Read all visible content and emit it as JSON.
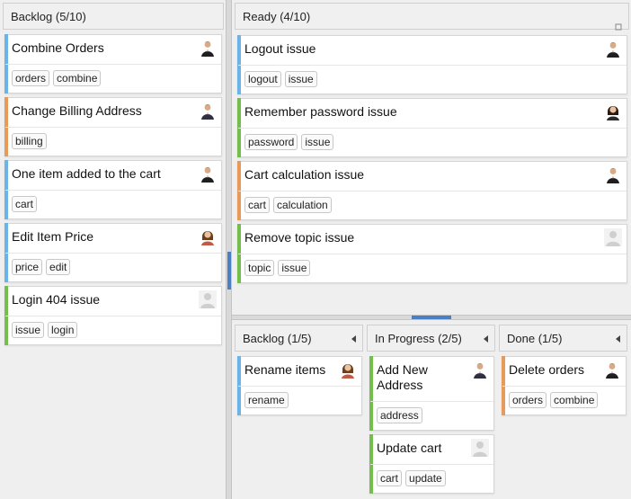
{
  "colors": {
    "blue": "#6ab4e8",
    "orange": "#e79a5a",
    "green": "#73be4c"
  },
  "left": {
    "header": "Backlog (5/10)",
    "cards": [
      {
        "title": "Combine Orders",
        "tags": [
          "orders",
          "combine"
        ],
        "color": "blue",
        "avatar": "man-suit"
      },
      {
        "title": "Change Billing Address",
        "tags": [
          "billing"
        ],
        "color": "orange",
        "avatar": "man-suit-2"
      },
      {
        "title": "One item added to the cart",
        "tags": [
          "cart"
        ],
        "color": "blue",
        "avatar": "man-suit"
      },
      {
        "title": "Edit Item Price",
        "tags": [
          "price",
          "edit"
        ],
        "color": "blue",
        "avatar": "woman"
      },
      {
        "title": "Login 404 issue",
        "tags": [
          "issue",
          "login"
        ],
        "color": "green",
        "avatar": "placeholder"
      }
    ]
  },
  "ready": {
    "header": "Ready (4/10)",
    "cards": [
      {
        "title": "Logout issue",
        "tags": [
          "logout",
          "issue"
        ],
        "color": "blue",
        "avatar": "man-suit"
      },
      {
        "title": "Remember password issue",
        "tags": [
          "password",
          "issue"
        ],
        "color": "green",
        "avatar": "woman-dark"
      },
      {
        "title": "Cart calculation issue",
        "tags": [
          "cart",
          "calculation"
        ],
        "color": "orange",
        "avatar": "man-suit"
      },
      {
        "title": "Remove topic issue",
        "tags": [
          "topic",
          "issue"
        ],
        "color": "green",
        "avatar": "placeholder"
      }
    ]
  },
  "bottom": {
    "columns": [
      {
        "header": "Backlog (1/5)",
        "cards": [
          {
            "title": "Rename items",
            "tags": [
              "rename"
            ],
            "color": "blue",
            "avatar": "woman-smile"
          }
        ]
      },
      {
        "header": "In Progress (2/5)",
        "cards": [
          {
            "title": "Add New Address",
            "title_lines": [
              "Add New",
              "Address"
            ],
            "tags": [
              "address"
            ],
            "color": "green",
            "avatar": "man-suit-2"
          },
          {
            "title": "Update cart",
            "tags": [
              "cart",
              "update"
            ],
            "color": "green",
            "avatar": "placeholder"
          }
        ]
      },
      {
        "header": "Done (1/5)",
        "cards": [
          {
            "title": "Delete orders",
            "tags": [
              "orders",
              "combine"
            ],
            "color": "orange",
            "avatar": "man-suit"
          }
        ]
      }
    ]
  }
}
